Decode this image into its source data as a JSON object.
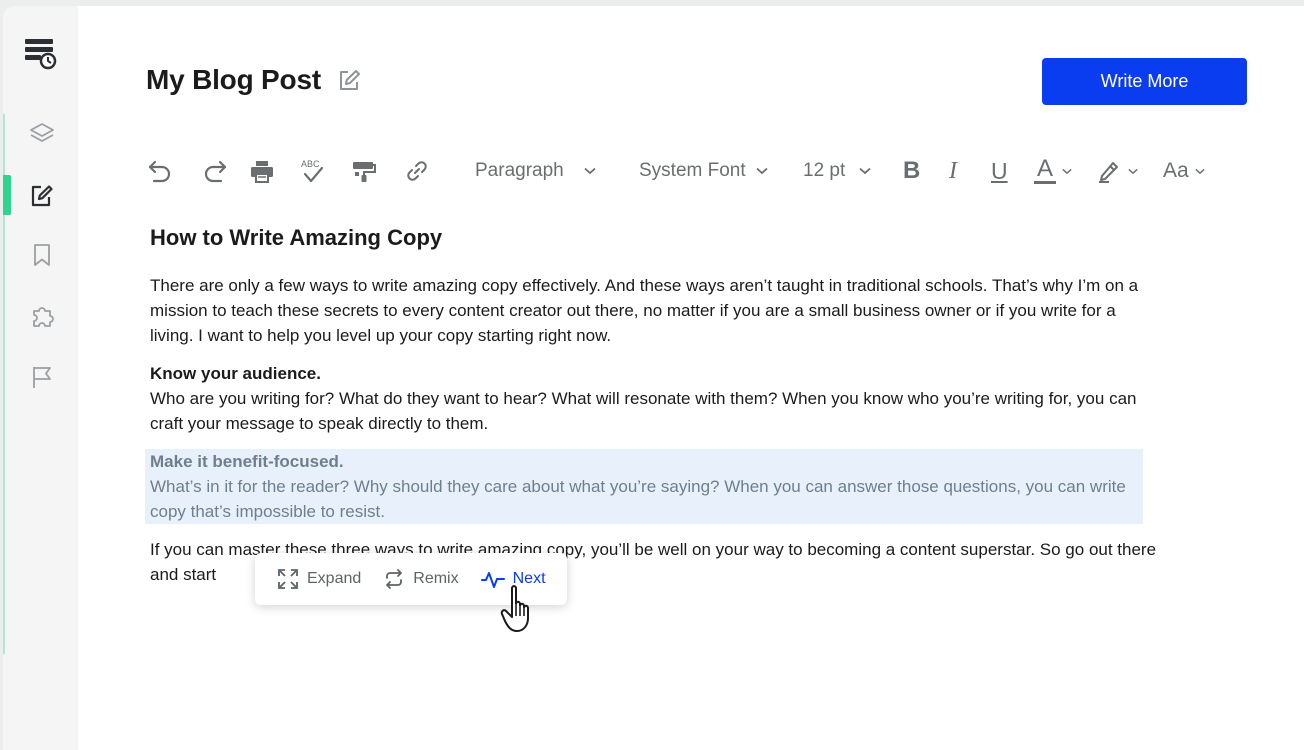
{
  "app": {
    "page_title": "My Blog Post",
    "write_more_label": "Write More"
  },
  "sidebar": {
    "items": [
      {
        "name": "layers",
        "icon": "layers-icon"
      },
      {
        "name": "editor",
        "icon": "edit-icon",
        "active": true
      },
      {
        "name": "bookmarks",
        "icon": "bookmark-icon"
      },
      {
        "name": "plugins",
        "icon": "puzzle-icon"
      },
      {
        "name": "flags",
        "icon": "flag-icon"
      }
    ],
    "active_color": "#2fd58a"
  },
  "toolbar": {
    "block_format": "Paragraph",
    "font_family": "System Font",
    "font_size": "12 pt",
    "bold": "B",
    "italic": "I",
    "underline": "U",
    "text_color": "A",
    "case": "Aa",
    "spellcheck_label": "ABC"
  },
  "document": {
    "heading": "How to Write Amazing Copy",
    "intro": "There are only a few ways to write amazing copy effectively. And these ways aren’t taught in traditional schools. That’s why I’m on a mission to teach these secrets to every content creator out there, no matter if you are a small business owner or if you write for a living. I want to help you level up your copy starting right now.",
    "section1_title": "Know your audience.",
    "section1_body": "Who are you writing for? What do they want to hear? What will resonate with them? When you know who you’re writing for, you can craft your message to speak directly to them.",
    "section2_title": "Make it benefit-focused.",
    "section2_body": "What’s in it for the reader? Why should they care about what you’re saying? When you can answer those questions, you can write copy that’s impossible to resist.",
    "closing": "If you can master these three ways to write amazing copy, you’ll be well on your way to becoming a content superstar. So go out there and start"
  },
  "popup": {
    "expand_label": "Expand",
    "remix_label": "Remix",
    "next_label": "Next"
  },
  "colors": {
    "accent": "#0a3cf0",
    "highlight_bg": "#e8f1fb",
    "sidebar_active": "#2fd58a"
  }
}
